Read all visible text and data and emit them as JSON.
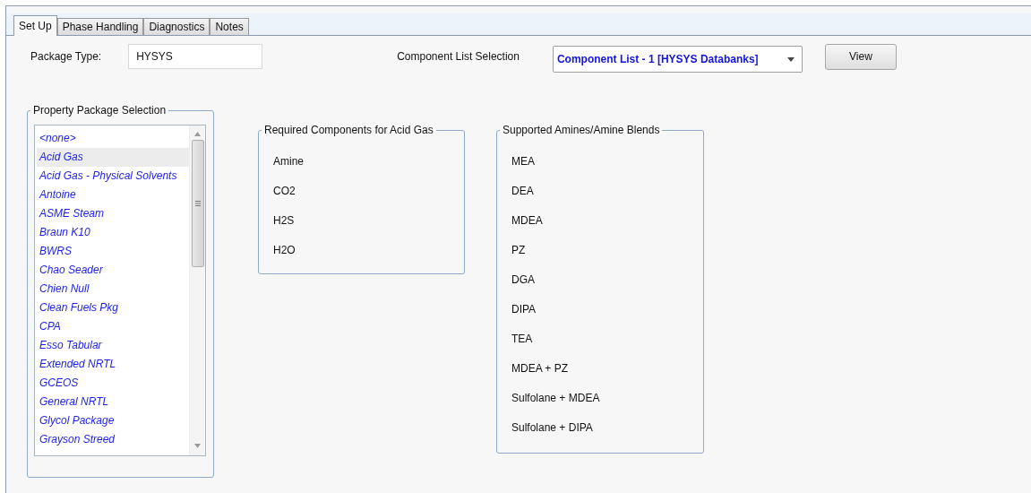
{
  "tabs": [
    {
      "label": "Set Up",
      "selected": true
    },
    {
      "label": "Phase Handling",
      "selected": false
    },
    {
      "label": "Diagnostics",
      "selected": false
    },
    {
      "label": "Notes",
      "selected": false
    }
  ],
  "package_type": {
    "label": "Package Type:",
    "value": "HYSYS"
  },
  "component_list": {
    "label": "Component List Selection",
    "value": "Component List - 1 [HYSYS Databanks]"
  },
  "view_button": "View",
  "property_package": {
    "title": "Property Package Selection",
    "items": [
      {
        "label": "<none>",
        "selected": false
      },
      {
        "label": "Acid Gas",
        "selected": true
      },
      {
        "label": "Acid Gas - Physical Solvents",
        "selected": false
      },
      {
        "label": "Antoine",
        "selected": false
      },
      {
        "label": "ASME Steam",
        "selected": false
      },
      {
        "label": "Braun K10",
        "selected": false
      },
      {
        "label": "BWRS",
        "selected": false
      },
      {
        "label": "Chao Seader",
        "selected": false
      },
      {
        "label": "Chien Null",
        "selected": false
      },
      {
        "label": "Clean Fuels Pkg",
        "selected": false
      },
      {
        "label": "CPA",
        "selected": false
      },
      {
        "label": "Esso Tabular",
        "selected": false
      },
      {
        "label": "Extended NRTL",
        "selected": false
      },
      {
        "label": "GCEOS",
        "selected": false
      },
      {
        "label": "General NRTL",
        "selected": false
      },
      {
        "label": "Glycol Package",
        "selected": false
      },
      {
        "label": "Grayson Streed",
        "selected": false
      }
    ]
  },
  "required_components": {
    "title": "Required Components for Acid Gas",
    "items": [
      "Amine",
      "CO2",
      "H2S",
      "H2O"
    ]
  },
  "supported_amines": {
    "title": "Supported Amines/Amine Blends",
    "items": [
      "MEA",
      "DEA",
      "MDEA",
      "PZ",
      "DGA",
      "DIPA",
      "TEA",
      "MDEA + PZ",
      "Sulfolane + MDEA",
      "Sulfolane + DIPA"
    ]
  }
}
